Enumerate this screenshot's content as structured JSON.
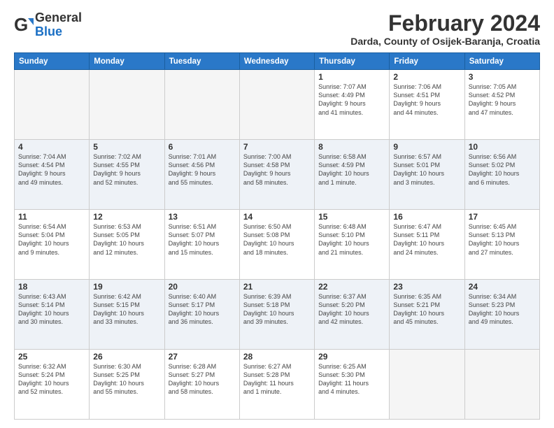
{
  "logo": {
    "general": "General",
    "blue": "Blue"
  },
  "title": "February 2024",
  "subtitle": "Darda, County of Osijek-Baranja, Croatia",
  "headers": [
    "Sunday",
    "Monday",
    "Tuesday",
    "Wednesday",
    "Thursday",
    "Friday",
    "Saturday"
  ],
  "weeks": [
    [
      {
        "day": "",
        "info": ""
      },
      {
        "day": "",
        "info": ""
      },
      {
        "day": "",
        "info": ""
      },
      {
        "day": "",
        "info": ""
      },
      {
        "day": "1",
        "info": "Sunrise: 7:07 AM\nSunset: 4:49 PM\nDaylight: 9 hours\nand 41 minutes."
      },
      {
        "day": "2",
        "info": "Sunrise: 7:06 AM\nSunset: 4:51 PM\nDaylight: 9 hours\nand 44 minutes."
      },
      {
        "day": "3",
        "info": "Sunrise: 7:05 AM\nSunset: 4:52 PM\nDaylight: 9 hours\nand 47 minutes."
      }
    ],
    [
      {
        "day": "4",
        "info": "Sunrise: 7:04 AM\nSunset: 4:54 PM\nDaylight: 9 hours\nand 49 minutes."
      },
      {
        "day": "5",
        "info": "Sunrise: 7:02 AM\nSunset: 4:55 PM\nDaylight: 9 hours\nand 52 minutes."
      },
      {
        "day": "6",
        "info": "Sunrise: 7:01 AM\nSunset: 4:56 PM\nDaylight: 9 hours\nand 55 minutes."
      },
      {
        "day": "7",
        "info": "Sunrise: 7:00 AM\nSunset: 4:58 PM\nDaylight: 9 hours\nand 58 minutes."
      },
      {
        "day": "8",
        "info": "Sunrise: 6:58 AM\nSunset: 4:59 PM\nDaylight: 10 hours\nand 1 minute."
      },
      {
        "day": "9",
        "info": "Sunrise: 6:57 AM\nSunset: 5:01 PM\nDaylight: 10 hours\nand 3 minutes."
      },
      {
        "day": "10",
        "info": "Sunrise: 6:56 AM\nSunset: 5:02 PM\nDaylight: 10 hours\nand 6 minutes."
      }
    ],
    [
      {
        "day": "11",
        "info": "Sunrise: 6:54 AM\nSunset: 5:04 PM\nDaylight: 10 hours\nand 9 minutes."
      },
      {
        "day": "12",
        "info": "Sunrise: 6:53 AM\nSunset: 5:05 PM\nDaylight: 10 hours\nand 12 minutes."
      },
      {
        "day": "13",
        "info": "Sunrise: 6:51 AM\nSunset: 5:07 PM\nDaylight: 10 hours\nand 15 minutes."
      },
      {
        "day": "14",
        "info": "Sunrise: 6:50 AM\nSunset: 5:08 PM\nDaylight: 10 hours\nand 18 minutes."
      },
      {
        "day": "15",
        "info": "Sunrise: 6:48 AM\nSunset: 5:10 PM\nDaylight: 10 hours\nand 21 minutes."
      },
      {
        "day": "16",
        "info": "Sunrise: 6:47 AM\nSunset: 5:11 PM\nDaylight: 10 hours\nand 24 minutes."
      },
      {
        "day": "17",
        "info": "Sunrise: 6:45 AM\nSunset: 5:13 PM\nDaylight: 10 hours\nand 27 minutes."
      }
    ],
    [
      {
        "day": "18",
        "info": "Sunrise: 6:43 AM\nSunset: 5:14 PM\nDaylight: 10 hours\nand 30 minutes."
      },
      {
        "day": "19",
        "info": "Sunrise: 6:42 AM\nSunset: 5:15 PM\nDaylight: 10 hours\nand 33 minutes."
      },
      {
        "day": "20",
        "info": "Sunrise: 6:40 AM\nSunset: 5:17 PM\nDaylight: 10 hours\nand 36 minutes."
      },
      {
        "day": "21",
        "info": "Sunrise: 6:39 AM\nSunset: 5:18 PM\nDaylight: 10 hours\nand 39 minutes."
      },
      {
        "day": "22",
        "info": "Sunrise: 6:37 AM\nSunset: 5:20 PM\nDaylight: 10 hours\nand 42 minutes."
      },
      {
        "day": "23",
        "info": "Sunrise: 6:35 AM\nSunset: 5:21 PM\nDaylight: 10 hours\nand 45 minutes."
      },
      {
        "day": "24",
        "info": "Sunrise: 6:34 AM\nSunset: 5:23 PM\nDaylight: 10 hours\nand 49 minutes."
      }
    ],
    [
      {
        "day": "25",
        "info": "Sunrise: 6:32 AM\nSunset: 5:24 PM\nDaylight: 10 hours\nand 52 minutes."
      },
      {
        "day": "26",
        "info": "Sunrise: 6:30 AM\nSunset: 5:25 PM\nDaylight: 10 hours\nand 55 minutes."
      },
      {
        "day": "27",
        "info": "Sunrise: 6:28 AM\nSunset: 5:27 PM\nDaylight: 10 hours\nand 58 minutes."
      },
      {
        "day": "28",
        "info": "Sunrise: 6:27 AM\nSunset: 5:28 PM\nDaylight: 11 hours\nand 1 minute."
      },
      {
        "day": "29",
        "info": "Sunrise: 6:25 AM\nSunset: 5:30 PM\nDaylight: 11 hours\nand 4 minutes."
      },
      {
        "day": "",
        "info": ""
      },
      {
        "day": "",
        "info": ""
      }
    ]
  ]
}
